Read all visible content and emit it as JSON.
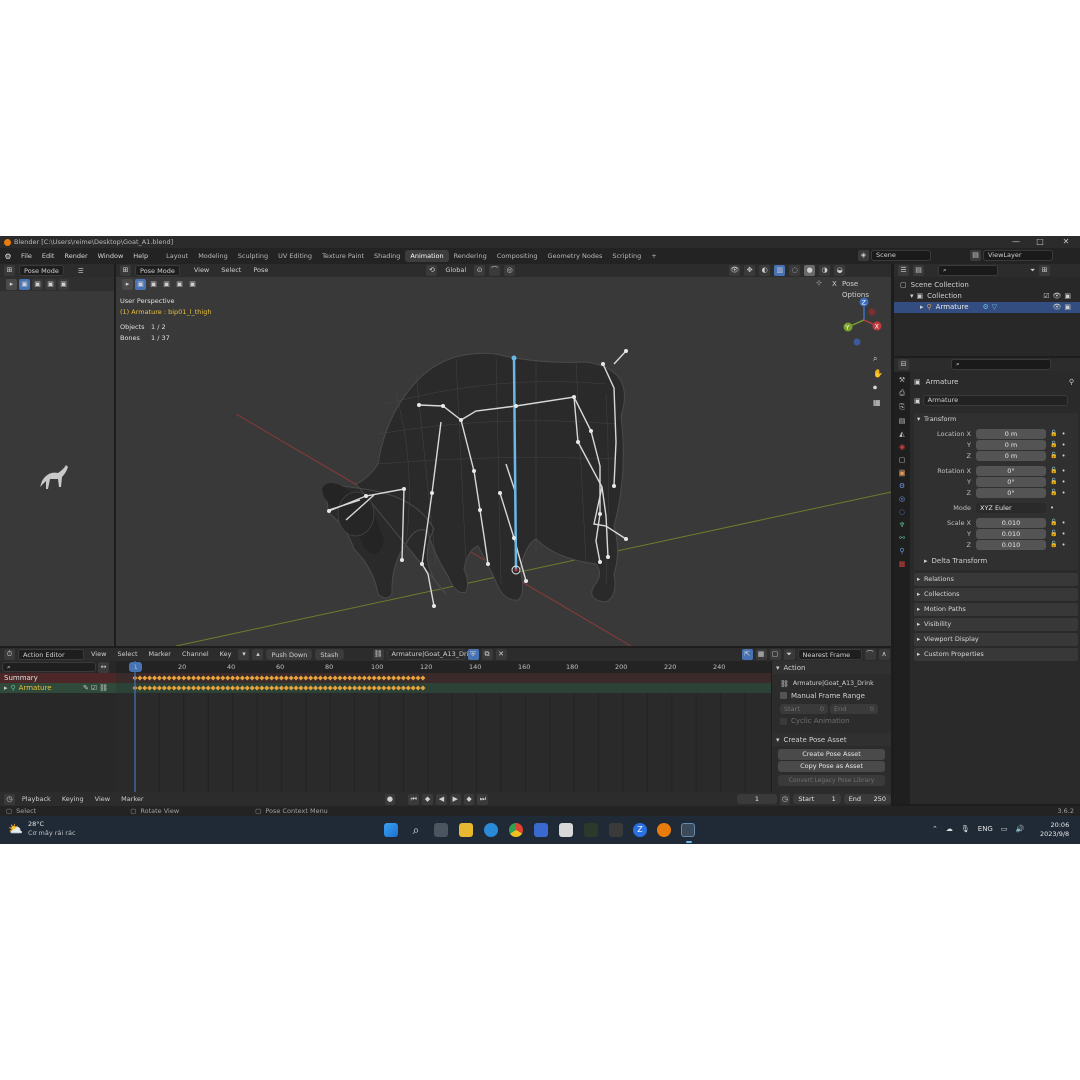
{
  "titlebar": {
    "title": "Blender [C:\\Users\\reime\\Desktop\\Goat_A1.blend]",
    "minimize": "—",
    "maximize": "□",
    "close": "✕"
  },
  "menu": [
    "File",
    "Edit",
    "Render",
    "Window",
    "Help"
  ],
  "workspaces": [
    "Layout",
    "Modeling",
    "Sculpting",
    "UV Editing",
    "Texture Paint",
    "Shading",
    "Animation",
    "Rendering",
    "Compositing",
    "Geometry Nodes",
    "Scripting"
  ],
  "active_workspace": "Animation",
  "add_workspace": "+",
  "scene_name": "Scene",
  "view_layer": "ViewLayer",
  "left_panel": {
    "mode": "Pose Mode"
  },
  "viewport_header": {
    "mode": "Pose Mode",
    "menus": [
      "View",
      "Select",
      "Pose"
    ],
    "orientation": "Global",
    "pose_options": "Pose Options",
    "x_label": "X"
  },
  "viewport_info": {
    "perspective": "User Perspective",
    "selection": "(1) Armature : bip01_l_thigh",
    "objects_label": "Objects",
    "objects_value": "1 / 2",
    "bones_label": "Bones",
    "bones_value": "1 / 37"
  },
  "gizmo": {
    "z": "Z",
    "y": "Y",
    "x": "X"
  },
  "outliner": {
    "scene_collection": "Scene Collection",
    "collection": "Collection",
    "armature": "Armature"
  },
  "properties": {
    "object_name": "Armature",
    "data_name": "Armature",
    "transform_label": "Transform",
    "location_x_label": "Location X",
    "y_label": "Y",
    "z_label": "Z",
    "location": [
      "0 m",
      "0 m",
      "0 m"
    ],
    "rotation_x_label": "Rotation X",
    "rotation": [
      "0°",
      "0°",
      "0°"
    ],
    "mode_label": "Mode",
    "mode_value": "XYZ Euler",
    "scale_x_label": "Scale X",
    "scale": [
      "0.010",
      "0.010",
      "0.010"
    ],
    "delta": "Delta Transform",
    "sections": [
      "Relations",
      "Collections",
      "Motion Paths",
      "Visibility",
      "Viewport Display",
      "Custom Properties"
    ]
  },
  "action_editor": {
    "editor_name": "Action Editor",
    "menus": [
      "View",
      "Select",
      "Marker",
      "Channel",
      "Key"
    ],
    "push_down": "Push Down",
    "stash": "Stash",
    "action_name": "Armature|Goat_A13_Drink",
    "snap": "Nearest Frame",
    "current_frame_marker": "1",
    "ruler": [
      "20",
      "40",
      "60",
      "80",
      "100",
      "120",
      "140",
      "160",
      "180",
      "200",
      "220",
      "240"
    ],
    "channels": {
      "summary": "Summary",
      "armature": "Armature"
    },
    "key_start_frame": 1,
    "key_end_frame": 120
  },
  "action_sidebar": {
    "action_header": "Action",
    "action_name": "Armature|Goat_A13_Drink",
    "manual_range": "Manual Frame Range",
    "start_label": "Start",
    "start_value": "0",
    "end_label": "End",
    "end_value": "0",
    "cyclic": "Cyclic Animation",
    "create_pose_header": "Create Pose Asset",
    "create_pose_btn": "Create Pose Asset",
    "copy_pose_btn": "Copy Pose as Asset",
    "convert_btn": "Convert Legacy Pose Library"
  },
  "timeline": {
    "menus": [
      "Playback",
      "Keying",
      "View",
      "Marker"
    ],
    "current_frame": "1",
    "start_label": "Start",
    "start_value": "1",
    "end_label": "End",
    "end_value": "250"
  },
  "statusbar": {
    "select": "Select",
    "rotate": "Rotate View",
    "context": "Pose Context Menu",
    "version": "3.6.2"
  },
  "taskbar": {
    "weather_temp": "28°C",
    "weather_desc": "Cơ mây rải rác",
    "lang": "ENG",
    "time": "20:06",
    "date": "2023/9/8"
  },
  "colors": {
    "accent_blue": "#4772b3",
    "key_orange": "#e8a33c",
    "axis_red": "#a83838",
    "axis_green": "#7a9a2a",
    "bone_selected": "#6ab7e8"
  }
}
